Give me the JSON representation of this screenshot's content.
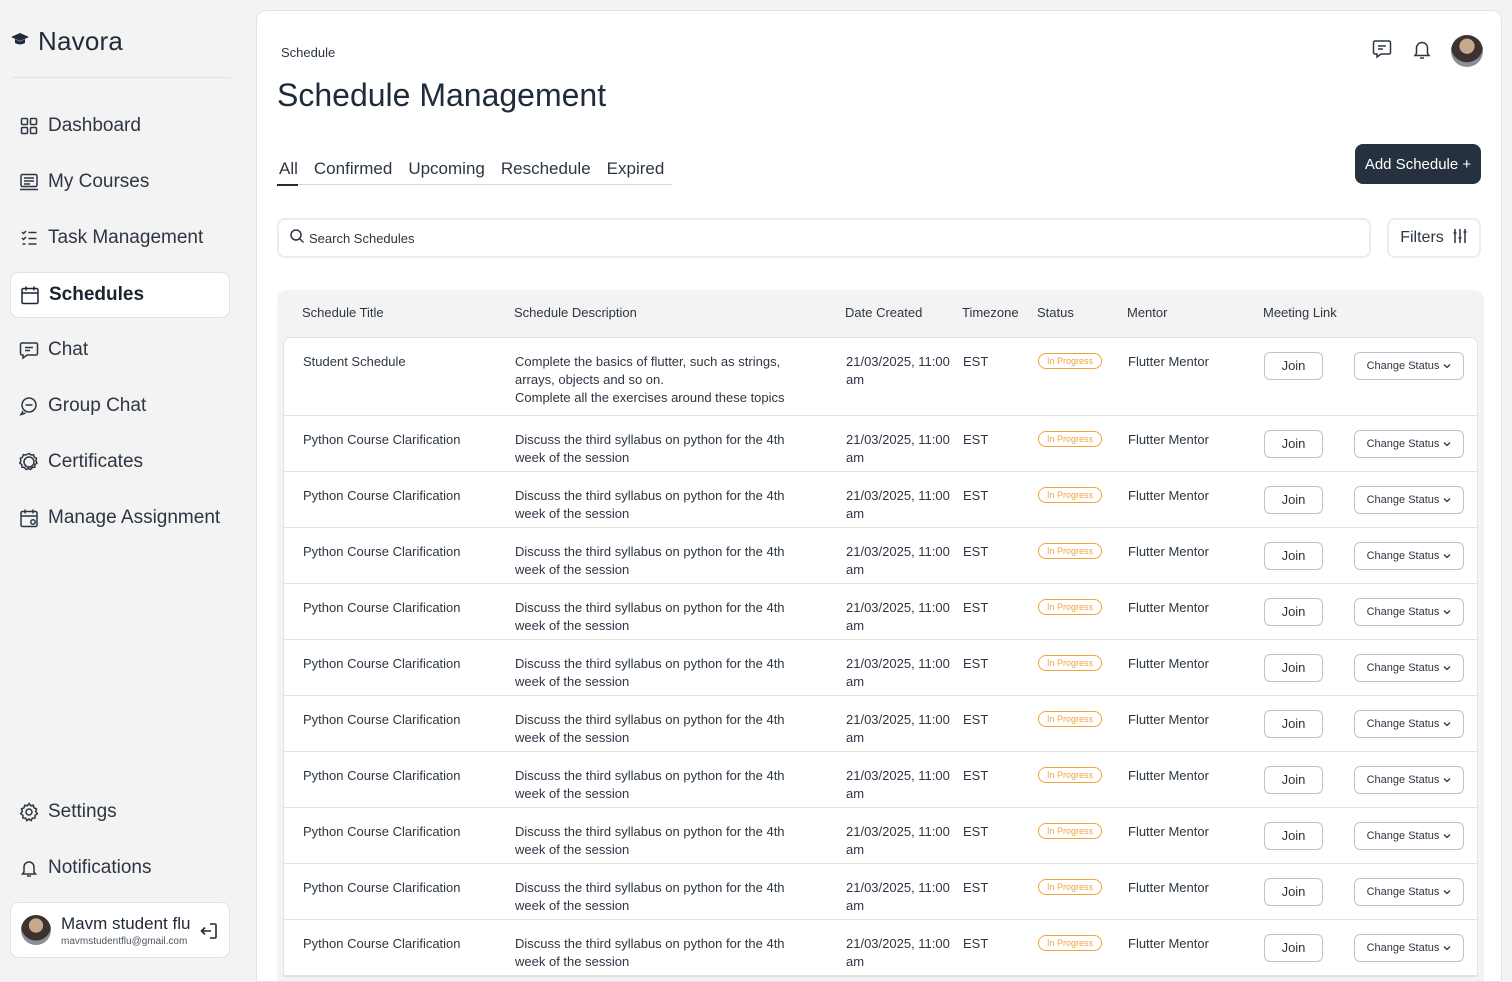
{
  "app": {
    "name": "Navora"
  },
  "sidebar": {
    "items": [
      {
        "label": "Dashboard",
        "icon": "grid-icon"
      },
      {
        "label": "My Courses",
        "icon": "courses-icon"
      },
      {
        "label": "Task Management",
        "icon": "checklist-icon"
      },
      {
        "label": "Schedules",
        "icon": "calendar-icon",
        "active": true
      },
      {
        "label": "Chat",
        "icon": "chat-icon"
      },
      {
        "label": "Group Chat",
        "icon": "group-chat-icon"
      },
      {
        "label": "Certificates",
        "icon": "certificate-icon"
      },
      {
        "label": "Manage Assignment",
        "icon": "assignment-icon"
      }
    ],
    "bottom_items": [
      {
        "label": "Settings",
        "icon": "gear-icon"
      },
      {
        "label": "Notifications",
        "icon": "bell-icon"
      }
    ],
    "user": {
      "name": "Mavm student flu",
      "email": "mavmstudentflu@gmail.com"
    }
  },
  "header": {
    "breadcrumb": "Schedule",
    "title": "Schedule Management"
  },
  "tabs": [
    {
      "label": "All",
      "active": true
    },
    {
      "label": "Confirmed"
    },
    {
      "label": "Upcoming"
    },
    {
      "label": "Reschedule"
    },
    {
      "label": "Expired"
    }
  ],
  "add_button": "Add Schedule +",
  "search": {
    "placeholder": "Search Schedules"
  },
  "filters_label": "Filters",
  "table": {
    "columns": [
      "Schedule Title",
      "Schedule Description",
      "Date Created",
      "Timezone",
      "Status",
      "Mentor",
      "Meeting Link"
    ],
    "join_label": "Join",
    "change_status_label": "Change Status",
    "rows": [
      {
        "title": "Student Schedule",
        "desc": "Complete the basics of flutter, such as strings, arrays, objects and so on.",
        "desc2": "Complete all the exercises around these topics",
        "date": "21/03/2025, 11:00 am",
        "tz": "EST",
        "status": "In Progress",
        "mentor": "Flutter Mentor"
      },
      {
        "title": "Python Course Clarification",
        "desc": "Discuss the third syllabus on python for the 4th week of the session",
        "date": "21/03/2025, 11:00 am",
        "tz": "EST",
        "status": "In Progress",
        "mentor": "Flutter Mentor"
      },
      {
        "title": "Python Course Clarification",
        "desc": "Discuss the third syllabus on python for the 4th week of the session",
        "date": "21/03/2025, 11:00 am",
        "tz": "EST",
        "status": "In Progress",
        "mentor": "Flutter Mentor"
      },
      {
        "title": "Python Course Clarification",
        "desc": "Discuss the third syllabus on python for the 4th week of the session",
        "date": "21/03/2025, 11:00 am",
        "tz": "EST",
        "status": "In Progress",
        "mentor": "Flutter Mentor"
      },
      {
        "title": "Python Course Clarification",
        "desc": "Discuss the third syllabus on python for the 4th week of the session",
        "date": "21/03/2025, 11:00 am",
        "tz": "EST",
        "status": "In Progress",
        "mentor": "Flutter Mentor"
      },
      {
        "title": "Python Course Clarification",
        "desc": "Discuss the third syllabus on python for the 4th week of the session",
        "date": "21/03/2025, 11:00 am",
        "tz": "EST",
        "status": "In Progress",
        "mentor": "Flutter Mentor"
      },
      {
        "title": "Python Course Clarification",
        "desc": "Discuss the third syllabus on python for the 4th week of the session",
        "date": "21/03/2025, 11:00 am",
        "tz": "EST",
        "status": "In Progress",
        "mentor": "Flutter Mentor"
      },
      {
        "title": "Python Course Clarification",
        "desc": "Discuss the third syllabus on python for the 4th week of the session",
        "date": "21/03/2025, 11:00 am",
        "tz": "EST",
        "status": "In Progress",
        "mentor": "Flutter Mentor"
      },
      {
        "title": "Python Course Clarification",
        "desc": "Discuss the third syllabus on python for the 4th week of the session",
        "date": "21/03/2025, 11:00 am",
        "tz": "EST",
        "status": "In Progress",
        "mentor": "Flutter Mentor"
      },
      {
        "title": "Python Course Clarification",
        "desc": "Discuss the third syllabus on python for the 4th week of the session",
        "date": "21/03/2025, 11:00 am",
        "tz": "EST",
        "status": "In Progress",
        "mentor": "Flutter Mentor"
      },
      {
        "title": "Python Course Clarification",
        "desc": "Discuss the third syllabus on python for the 4th week of the session",
        "date": "21/03/2025, 11:00 am",
        "tz": "EST",
        "status": "In Progress",
        "mentor": "Flutter Mentor"
      }
    ]
  },
  "colors": {
    "primary": "#26313f",
    "status_in_progress": "#f3a23a",
    "background": "#f3f3f3"
  }
}
